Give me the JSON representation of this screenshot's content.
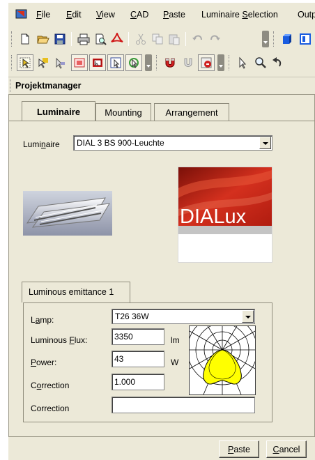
{
  "menu": {
    "items": [
      {
        "pre": "",
        "ul": "F",
        "post": "ile"
      },
      {
        "pre": "",
        "ul": "E",
        "post": "dit"
      },
      {
        "pre": "",
        "ul": "V",
        "post": "iew"
      },
      {
        "pre": "",
        "ul": "C",
        "post": "AD"
      },
      {
        "pre": "",
        "ul": "P",
        "post": "aste"
      },
      {
        "pre": "Luminaire ",
        "ul": "S",
        "post": "election"
      },
      {
        "pre": "",
        "ul": "",
        "post": "Outp"
      }
    ]
  },
  "toolbar1": {
    "icons": [
      "new-file-icon",
      "open-folder-icon",
      "save-icon",
      "print-icon",
      "print-preview-icon",
      "pdf-icon",
      "cut-icon",
      "copy-icon",
      "paste-icon",
      "undo-icon",
      "redo-icon",
      "3d-view-icon",
      "layout-icon"
    ]
  },
  "toolbar2": {
    "icons": [
      "select-objects-icon",
      "select-luminaire-icon",
      "select-arrow-icon",
      "view-toggle-1-icon",
      "view-toggle-2-icon",
      "select-frame-icon",
      "rotate-select-icon",
      "magnet-icon",
      "snap-icon",
      "settings-icon",
      "pointer-icon",
      "zoom-icon",
      "undo-arrow-icon"
    ]
  },
  "panel": {
    "title": "Projektmanager",
    "tabs": [
      {
        "label": "Luminaire",
        "active": true
      },
      {
        "label": "Mounting",
        "active": false
      },
      {
        "label": "Arrangement",
        "active": false
      }
    ],
    "luminaire": {
      "label_pre": "Lumi",
      "label_ul": "n",
      "label_post": "aire",
      "selected": "DIAL 3 BS 900-Leuchte"
    },
    "logo_text": "DIALux",
    "emittance": {
      "tab_label": "Luminous emittance 1",
      "lamp_label_pre": "L",
      "lamp_label_ul": "a",
      "lamp_label_post": "mp:",
      "lamp_value": "T26 36W",
      "flux_label_pre": "Luminous ",
      "flux_label_ul": "F",
      "flux_label_post": "lux:",
      "flux_value": "3350",
      "flux_unit": "lm",
      "power_label_pre": "",
      "power_label_ul": "P",
      "power_label_post": "ower:",
      "power_value": "43",
      "power_unit": "W",
      "correction_label_pre": "C",
      "correction_label_ul": "o",
      "correction_label_post": "rrection",
      "correction_value": "1.000",
      "correction2_label": "Correction",
      "correction2_value": ""
    }
  },
  "buttons": {
    "paste_pre": "",
    "paste_ul": "P",
    "paste_post": "aste",
    "cancel_pre": "",
    "cancel_ul": "C",
    "cancel_post": "ancel"
  },
  "colors": {
    "window_bg": "#ece9d8",
    "logo_red": "#c0281c",
    "ldc_fill": "#ffff00"
  }
}
